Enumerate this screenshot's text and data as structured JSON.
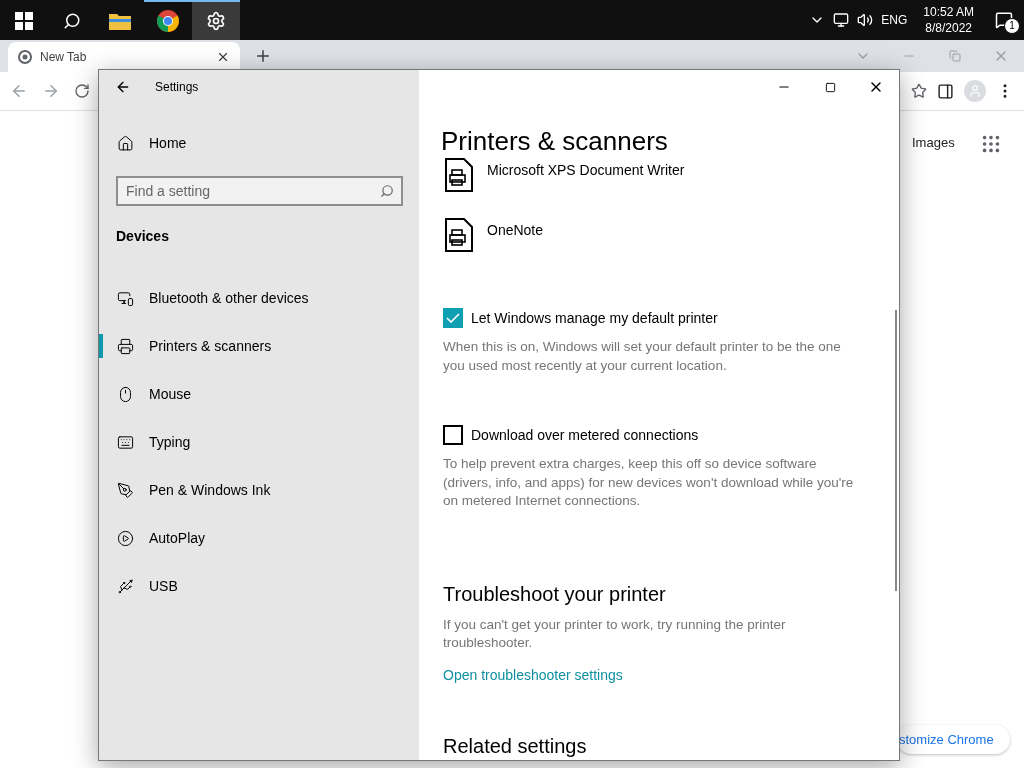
{
  "taskbar": {
    "apps": [
      {
        "kind": "explorer",
        "open": false,
        "selected": false
      },
      {
        "kind": "chrome",
        "open": true,
        "selected": false
      },
      {
        "kind": "settings",
        "open": true,
        "selected": true
      }
    ],
    "language": "ENG",
    "time": "10:52 AM",
    "date": "8/8/2022",
    "notification_count": "1"
  },
  "browser": {
    "tabs": [
      {
        "title": "New Tab",
        "selected": true
      }
    ],
    "page": {
      "images_link": "Images",
      "customize_button": "stomize Chrome"
    }
  },
  "settings_window": {
    "title": "Settings",
    "home": "Home",
    "search": {
      "placeholder": "Find a setting"
    },
    "section": "Devices",
    "nav_items": [
      {
        "kind": "bluetooth",
        "label": "Bluetooth & other devices",
        "selected": false
      },
      {
        "kind": "printer",
        "label": "Printers & scanners",
        "selected": true
      },
      {
        "kind": "mouse",
        "label": "Mouse",
        "selected": false
      },
      {
        "kind": "typing",
        "label": "Typing",
        "selected": false
      },
      {
        "kind": "pen",
        "label": "Pen & Windows Ink",
        "selected": false
      },
      {
        "kind": "autoplay",
        "label": "AutoPlay",
        "selected": false
      },
      {
        "kind": "usb",
        "label": "USB",
        "selected": false
      }
    ],
    "heading": "Printers & scanners",
    "printers": [
      {
        "name": "Microsoft XPS Document Writer"
      },
      {
        "name": "OneNote"
      }
    ],
    "options": [
      {
        "label": "Let Windows manage my default printer",
        "checked": true,
        "description": "When this is on, Windows will set your default printer to be the one you used most recently at your current location."
      },
      {
        "label": "Download over metered connections",
        "checked": false,
        "description": "To help prevent extra charges, keep this off so device software (drivers, info, and apps) for new devices won't download while you're on metered Internet connections."
      }
    ],
    "troubleshoot": {
      "heading": "Troubleshoot your printer",
      "text": "If you can't get your printer to work, try running the printer troubleshooter.",
      "link": "Open troubleshooter settings"
    },
    "related_heading": "Related settings"
  }
}
